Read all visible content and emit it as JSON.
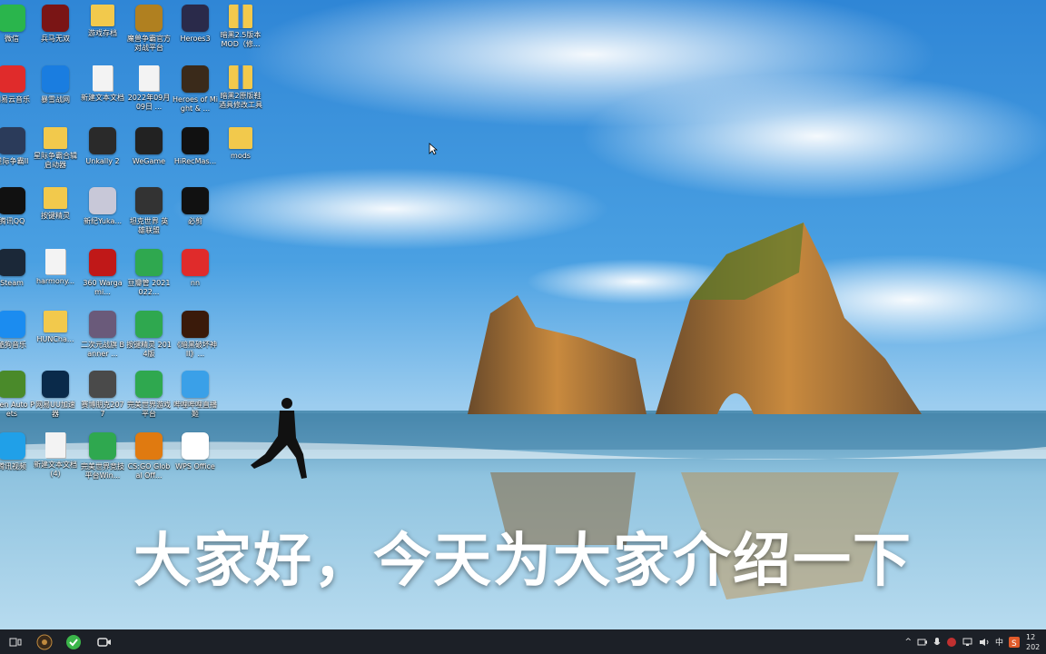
{
  "subtitle": "大家好，今天为大家介绍一下",
  "desktop_icons": [
    {
      "label": "微信",
      "icon": "wechat-icon",
      "color": "#2ab54c"
    },
    {
      "label": "网易云音乐",
      "icon": "netease-music-icon",
      "color": "#e02b2b"
    },
    {
      "label": "星际争霸II",
      "icon": "starcraft-icon",
      "color": "#2b3b5a"
    },
    {
      "label": "腾讯QQ",
      "icon": "qq-icon",
      "color": "#111111"
    },
    {
      "label": "Steam",
      "icon": "steam-icon",
      "color": "#1b2838"
    },
    {
      "label": "酷狗音乐",
      "icon": "kugou-icon",
      "color": "#1b8cf0"
    },
    {
      "label": "Open Auto Pets",
      "icon": "turtle-icon",
      "color": "#4a8a2a"
    },
    {
      "label": "腾讯视频",
      "icon": "tencent-video-icon",
      "color": "#20a0e8"
    },
    {
      "label": "兵马无双",
      "icon": "game-icon",
      "color": "#7a1515"
    },
    {
      "label": "暴雪战网",
      "icon": "battlenet-icon",
      "color": "#1a7de0"
    },
    {
      "label": "星际争霸合辑启动器",
      "icon": "folder-icon",
      "color": "#f2c94c"
    },
    {
      "label": "按键精灵",
      "icon": "folder-icon",
      "color": "#f2c94c"
    },
    {
      "label": "harmony...",
      "icon": "file-icon",
      "color": "#f3f3f3"
    },
    {
      "label": "HUNCha...",
      "icon": "folder-icon",
      "color": "#f2c94c"
    },
    {
      "label": "网易UU加速器",
      "icon": "uu-accelerator-icon",
      "color": "#0a2a4a"
    },
    {
      "label": "新建文本文档 (4)",
      "icon": "text-file-icon",
      "color": "#f3f3f3"
    },
    {
      "label": "游戏存档",
      "icon": "folder-icon",
      "color": "#f2c94c"
    },
    {
      "label": "新建文本文档",
      "icon": "file-icon",
      "color": "#f3f3f3"
    },
    {
      "label": "Unkally 2",
      "icon": "shield-game-icon",
      "color": "#2a2a2a"
    },
    {
      "label": "新纪Yuka...",
      "icon": "anime-icon",
      "color": "#c8c8d8"
    },
    {
      "label": "360 Wargami...",
      "icon": "wargaming-icon",
      "color": "#c01818"
    },
    {
      "label": "二次元战旗 Banner ...",
      "icon": "anime-icon",
      "color": "#6a5a7a"
    },
    {
      "label": "赛博朋克2077",
      "icon": "game-icon",
      "color": "#4a4a4a"
    },
    {
      "label": "完美世界竞技平台Win...",
      "icon": "green-m-icon",
      "color": "#2fa84f"
    },
    {
      "label": "魔兽争霸官方对战平台",
      "icon": "warcraft-icon",
      "color": "#b08020"
    },
    {
      "label": "2022年09月09日 ...",
      "icon": "file-icon",
      "color": "#f3f3f3"
    },
    {
      "label": "WeGame",
      "icon": "wegame-icon",
      "color": "#222222"
    },
    {
      "label": "坦克世界 英雄联盟",
      "icon": "tank-icon",
      "color": "#333333"
    },
    {
      "label": "豆瓣管 2021022...",
      "icon": "green-m-icon",
      "color": "#2fa84f"
    },
    {
      "label": "按键精灵 2014版",
      "icon": "green-square-icon",
      "color": "#2fa84f"
    },
    {
      "label": "完美世界游戏平台",
      "icon": "green-m-icon",
      "color": "#2fa84f"
    },
    {
      "label": "CS:GO Global Off...",
      "icon": "csgo-icon",
      "color": "#e07a10"
    },
    {
      "label": "Heroes3",
      "icon": "heroes-icon",
      "color": "#2a2a4a"
    },
    {
      "label": "Heroes of Might & ...",
      "icon": "heroes-icon",
      "color": "#3a2a1a"
    },
    {
      "label": "HiRecMas...",
      "icon": "recorder-icon",
      "color": "#111111"
    },
    {
      "label": "必剪",
      "icon": "bcut-icon",
      "color": "#111111"
    },
    {
      "label": "nn",
      "icon": "nn-icon",
      "color": "#e02b2b"
    },
    {
      "label": "《暗黑破坏神II》...",
      "icon": "diablo-icon",
      "color": "#3a1a0a"
    },
    {
      "label": "哔哩哔哩直播姬",
      "icon": "bilibili-live-icon",
      "color": "#3aa0e8"
    },
    {
      "label": "WPS Office",
      "icon": "wps-icon",
      "color": "#ffffff"
    },
    {
      "label": "暗黑2.5版本MOD（修...",
      "icon": "zip-icon",
      "color": "#f2c94c"
    },
    {
      "label": "暗黑2原版鞋酒具修改工具",
      "icon": "zip-icon",
      "color": "#f2c94c"
    },
    {
      "label": "mods",
      "icon": "folder-icon",
      "color": "#f2c94c"
    }
  ],
  "taskbar": {
    "buttons": [
      {
        "icon": "task-view-icon"
      },
      {
        "icon": "game-app-icon"
      },
      {
        "icon": "green-app-icon"
      },
      {
        "icon": "video-app-icon"
      }
    ],
    "tray": {
      "up_arrow": "^",
      "ime": "中",
      "clock_time": "12",
      "clock_date": "202"
    }
  }
}
